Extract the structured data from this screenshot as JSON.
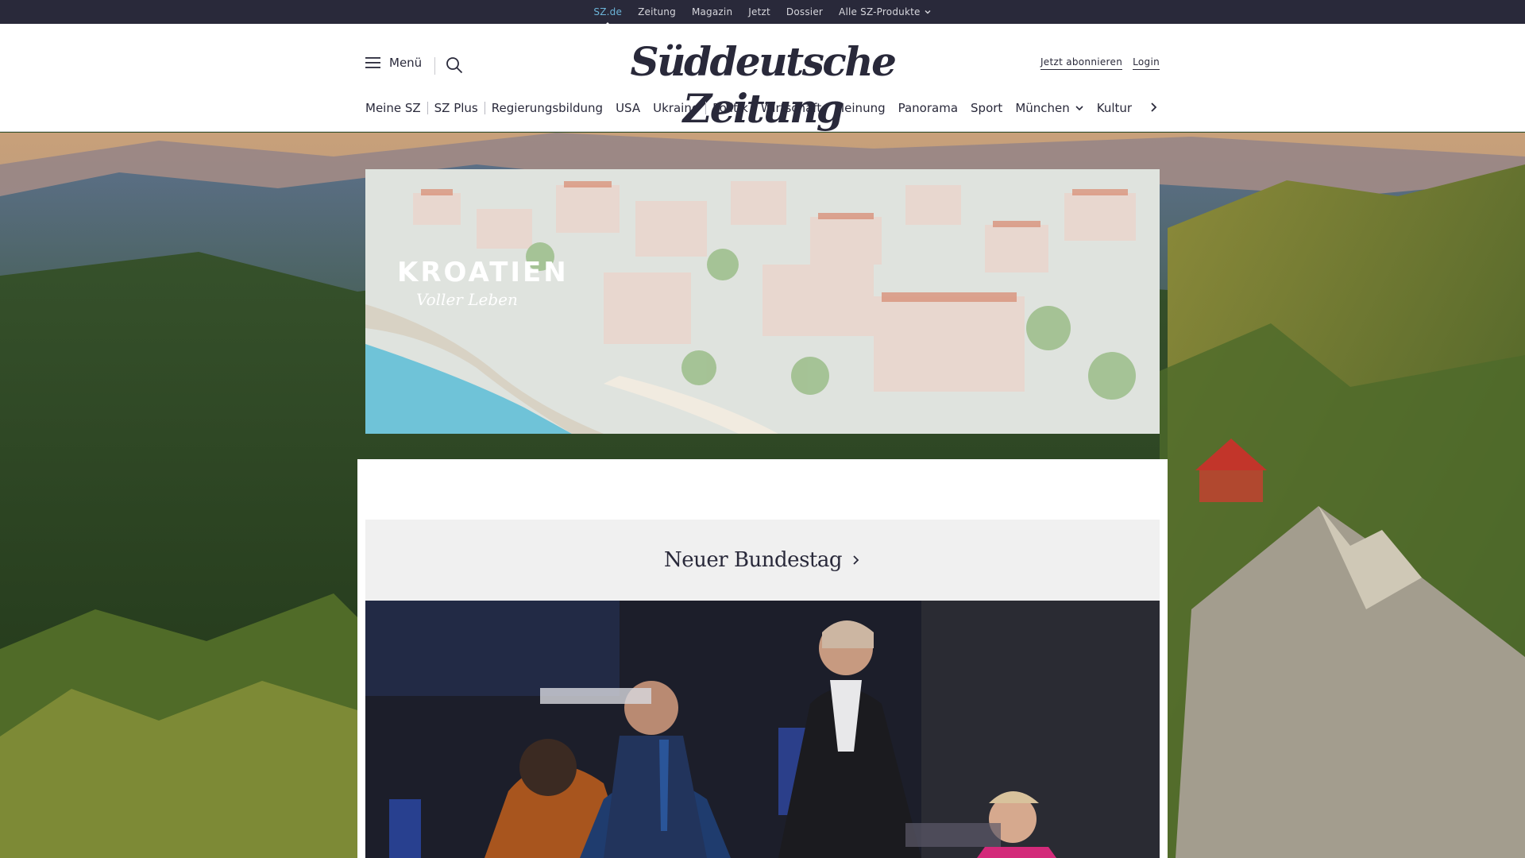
{
  "topbar": {
    "items": [
      {
        "label": "SZ.de",
        "active": true
      },
      {
        "label": "Zeitung"
      },
      {
        "label": "Magazin"
      },
      {
        "label": "Jetzt"
      },
      {
        "label": "Dossier"
      },
      {
        "label": "Alle SZ-Produkte",
        "has_dropdown": true
      }
    ],
    "icons": {
      "products_dropdown": "chevron-down-icon"
    }
  },
  "header": {
    "menu_label": "Menü",
    "logo_text": "Süddeutsche Zeitung",
    "subscribe_label": "Jetzt abonnieren",
    "login_label": "Login",
    "icons": {
      "menu": "hamburger-icon",
      "search": "search-icon",
      "nav_more": "chevron-right-icon"
    }
  },
  "nav": {
    "items": [
      "Meine SZ",
      "SZ Plus",
      "Regierungsbildung",
      "USA",
      "Ukraine",
      "Politik",
      "Wirtschaft",
      "Meinung",
      "Panorama",
      "Sport",
      "München",
      "Kultur"
    ],
    "dropdown_item": "München"
  },
  "ad": {
    "brand": "KROATIEN",
    "tagline": "Voller Leben"
  },
  "section": {
    "title": "Neuer Bundestag",
    "icon": "chevron-right-icon"
  },
  "colors": {
    "topbar_bg": "#29293a",
    "active_link": "#6cb4d8",
    "text": "#29293a",
    "section_bg": "#f0f0f0"
  }
}
